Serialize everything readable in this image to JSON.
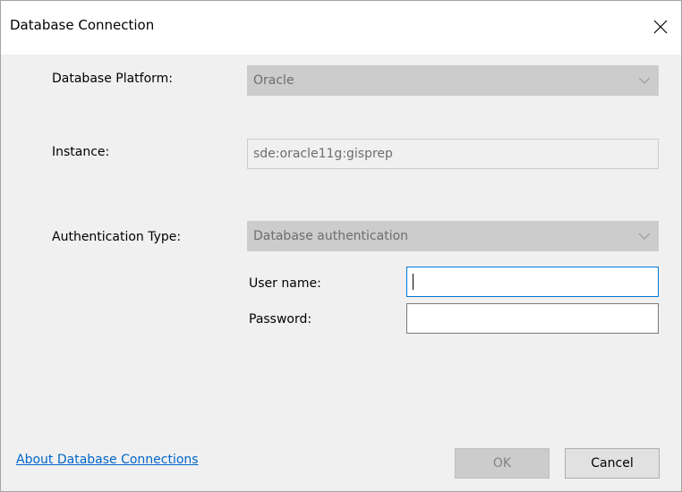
{
  "window": {
    "title": "Database Connection",
    "close_icon": "close-icon"
  },
  "form": {
    "platform": {
      "label": "Database Platform:",
      "value": "Oracle"
    },
    "instance": {
      "label": "Instance:",
      "value": "sde:oracle11g:gisprep"
    },
    "auth_type": {
      "label": "Authentication Type:",
      "value": "Database authentication"
    },
    "username": {
      "label": "User name:",
      "value": ""
    },
    "password": {
      "label": "Password:",
      "value": ""
    }
  },
  "footer": {
    "link_text": "About Database Connections",
    "ok_label": "OK",
    "cancel_label": "Cancel"
  },
  "colors": {
    "dialog_bg": "#f0f0f0",
    "disabled_combo": "#cccccc",
    "focus_border": "#0078d7",
    "link": "#0066cc"
  }
}
